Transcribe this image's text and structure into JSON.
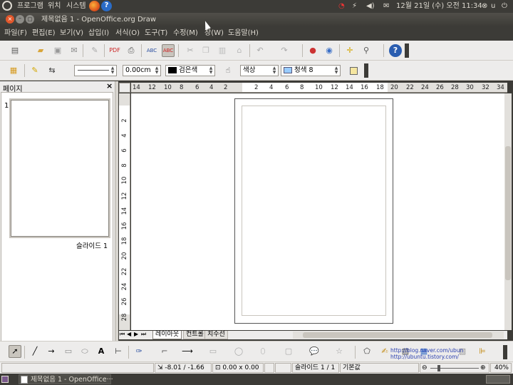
{
  "top_panel": {
    "menus": [
      "프로그램",
      "위치",
      "시스템"
    ],
    "clock": "12월 21일 (수) 오전 11:34",
    "user": "u"
  },
  "window": {
    "title": "제목없음 1 - OpenOffice.org Draw"
  },
  "menu": {
    "items": [
      "파일(F)",
      "편집(E)",
      "보기(V)",
      "삽입(I)",
      "서식(O)",
      "도구(T)",
      "수정(M)",
      "창(W)",
      "도움말(H)"
    ]
  },
  "line_toolbar": {
    "line_width": "0.00cm",
    "line_color": "검은색",
    "area_style": "색상",
    "area_color": "청색 8",
    "line_color_hex": "#000000",
    "area_color_hex": "#99ccff"
  },
  "pages_panel": {
    "title": "페이지",
    "close": "×",
    "slide_number": "1",
    "slide_label": "슬라이드 1"
  },
  "rulers": {
    "horizontal": [
      "14",
      "12",
      "10",
      "8",
      "6",
      "4",
      "2",
      "2",
      "4",
      "6",
      "8",
      "10",
      "12",
      "14",
      "16",
      "18",
      "20",
      "22",
      "24",
      "26",
      "28",
      "30",
      "32",
      "34"
    ],
    "vertical": [
      "2",
      "4",
      "6",
      "8",
      "10",
      "12",
      "14",
      "16",
      "18",
      "20",
      "22",
      "24",
      "26",
      "28"
    ]
  },
  "tabs": [
    "레이아웃",
    "컨트롤",
    "치수선"
  ],
  "watermark": {
    "line1": "http://blog.naver.com/ubun",
    "line2": "http://ubuntu.tistory.com/"
  },
  "status": {
    "position": "-8.01 / -1.66",
    "size": "0.00 x 0.00",
    "slide": "슬라이드 1 / 1",
    "layout": "기본값",
    "zoom": "40%"
  },
  "taskbar": {
    "task": "제목없음 1 - OpenOffice···"
  }
}
